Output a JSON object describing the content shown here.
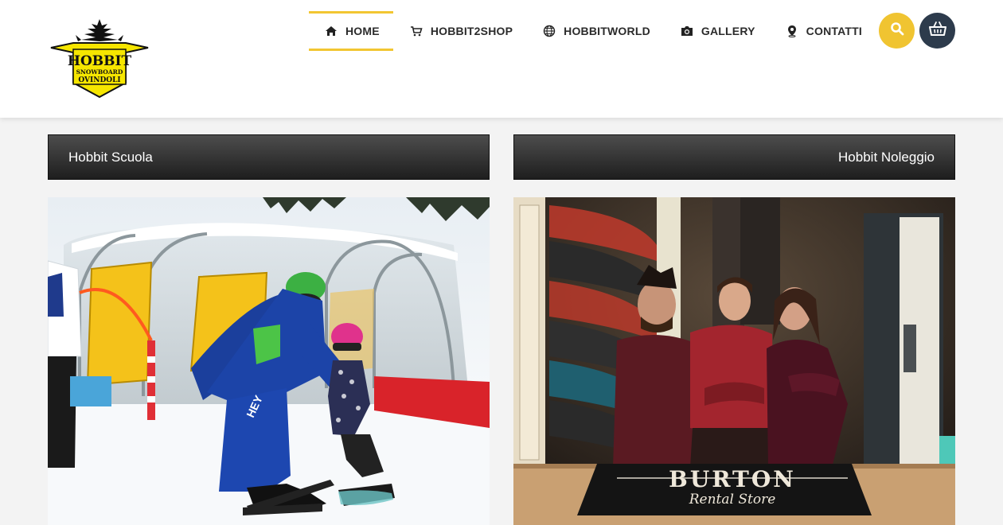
{
  "header": {
    "logo": {
      "alt": "Hobbit Snowboard Ovindoli logo",
      "line1": "HOBBIT",
      "line2": "SNOWBOARD",
      "line3": "OVINDOLI"
    },
    "nav": [
      {
        "label": "HOME",
        "icon": "home-icon",
        "active": true
      },
      {
        "label": "HOBBIT2SHOP",
        "icon": "cart-icon",
        "active": false
      },
      {
        "label": "HOBBITWORLD",
        "icon": "globe-icon",
        "active": false
      },
      {
        "label": "GALLERY",
        "icon": "camera-icon",
        "active": false
      },
      {
        "label": "CONTATTI",
        "icon": "location-pin-icon",
        "active": false
      }
    ],
    "search_icon": "search-icon",
    "basket_icon": "basket-icon"
  },
  "colors": {
    "accent": "#f2c631",
    "dark_button": "#2d3b4c",
    "bar_top": "#4d4d4d",
    "bar_bottom": "#1e1e1e"
  },
  "sections": {
    "left": {
      "title": "Hobbit Scuola",
      "image": "snowboard-lesson-photo"
    },
    "right": {
      "title": "Hobbit Noleggio",
      "image": "rental-store-photo"
    }
  },
  "rental_sign": {
    "line1": "BURTON",
    "line2": "Rental Store"
  },
  "jacket_text": "HEY"
}
